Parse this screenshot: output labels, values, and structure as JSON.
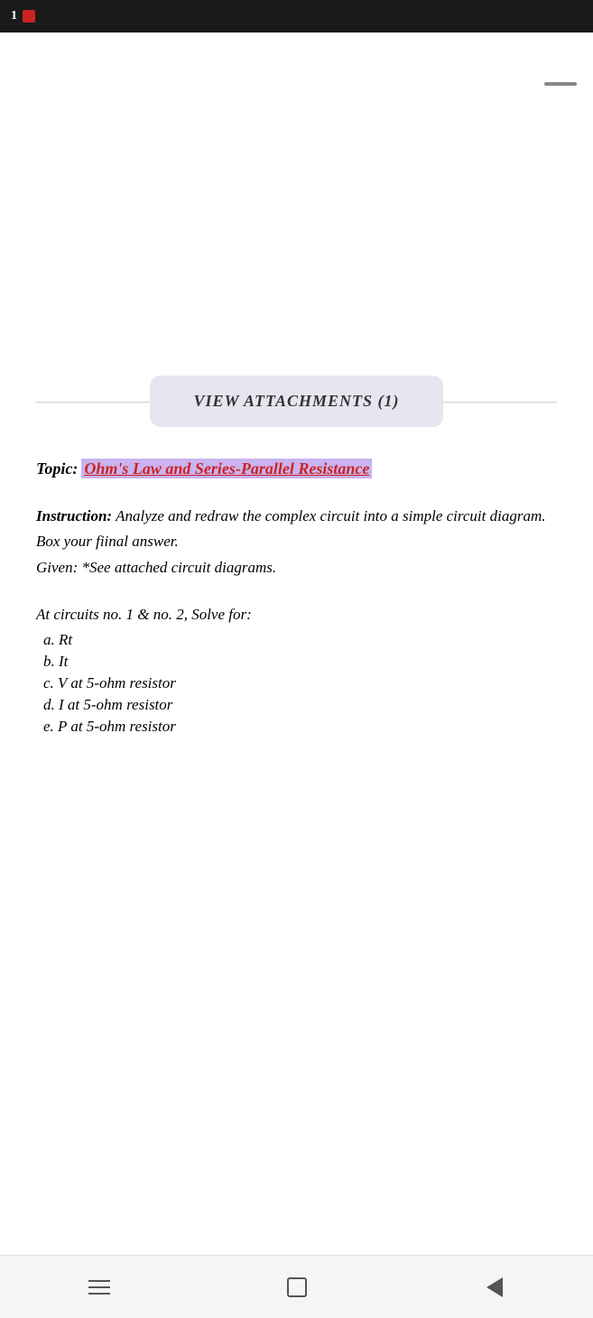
{
  "status_bar": {
    "time": "1",
    "indicator": "red"
  },
  "attachment_button": {
    "label": "VIEW ATTACHMENTS (1)"
  },
  "topic": {
    "label": "Topic:",
    "value": "Ohm's Law and Series-Parallel Resistance"
  },
  "instruction": {
    "label": "Instruction:",
    "text_1": " Analyze and redraw the complex circuit into a simple circuit diagram.  Box your fiinal answer.",
    "text_2": "Given: *See attached circuit diagrams."
  },
  "solve": {
    "heading": "At circuits no. 1 & no. 2,  Solve for:",
    "items": [
      {
        "id": "a",
        "text": "a.  Rt"
      },
      {
        "id": "b",
        "text": "b.  It"
      },
      {
        "id": "c",
        "text": "c.  V at 5-ohm resistor"
      },
      {
        "id": "d",
        "text": "d.  I at 5-ohm resistor"
      },
      {
        "id": "e",
        "text": "e.  P at 5-ohm resistor"
      }
    ]
  },
  "nav": {
    "menu_label": "menu",
    "home_label": "home",
    "back_label": "back"
  }
}
